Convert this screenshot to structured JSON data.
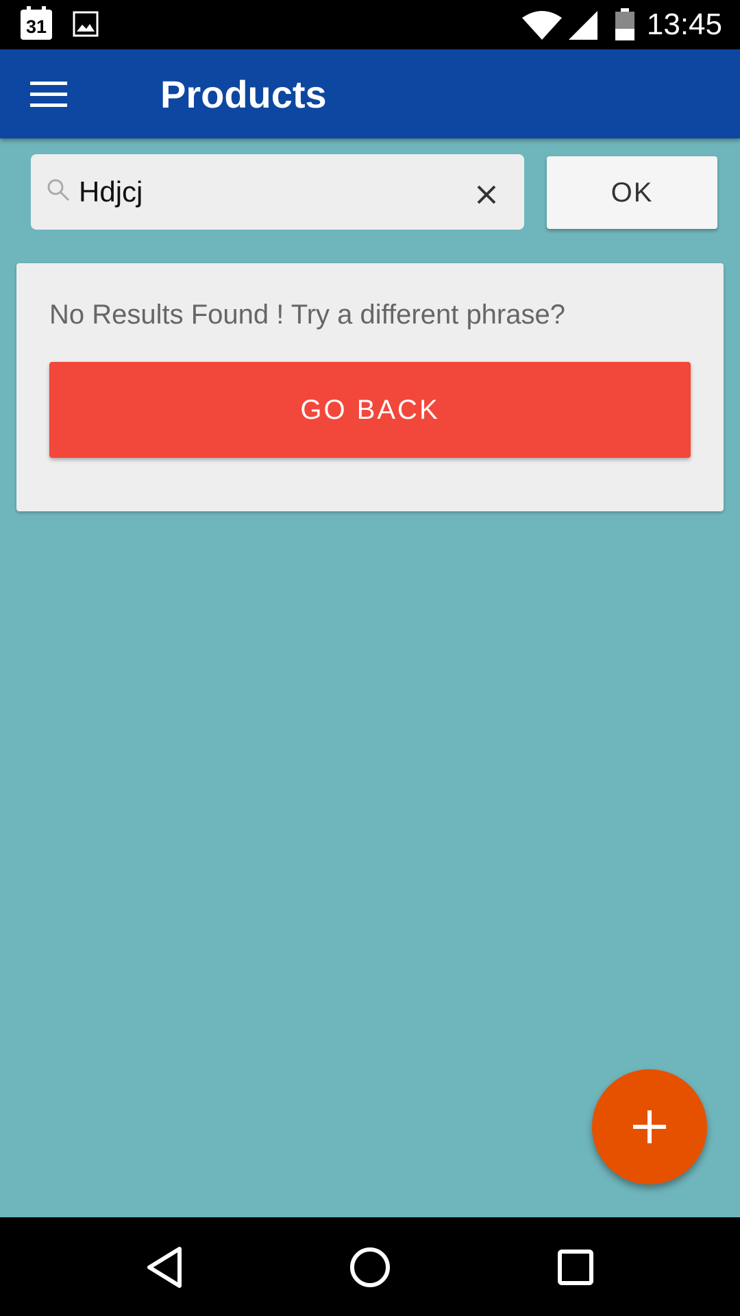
{
  "status_bar": {
    "calendar_day": "31",
    "time": "13:45",
    "icons": [
      "calendar-icon",
      "gallery-icon",
      "wifi-icon",
      "signal-icon",
      "battery-icon"
    ]
  },
  "app_bar": {
    "title": "Products",
    "menu_icon": "hamburger-menu-icon",
    "color": "#0d47a1"
  },
  "search": {
    "value": "Hdjcj",
    "search_icon": "search-icon",
    "clear_icon": "close-icon",
    "ok_label": "OK"
  },
  "result": {
    "message": "No Results Found ! Try a different phrase?",
    "go_back_label": "GO BACK",
    "button_color": "#f2483b"
  },
  "fab": {
    "icon": "plus-icon",
    "color": "#e65100"
  },
  "nav_bar": {
    "icons": [
      "back-icon",
      "home-icon",
      "recent-apps-icon"
    ]
  },
  "colors": {
    "background": "#6fb5bc"
  }
}
